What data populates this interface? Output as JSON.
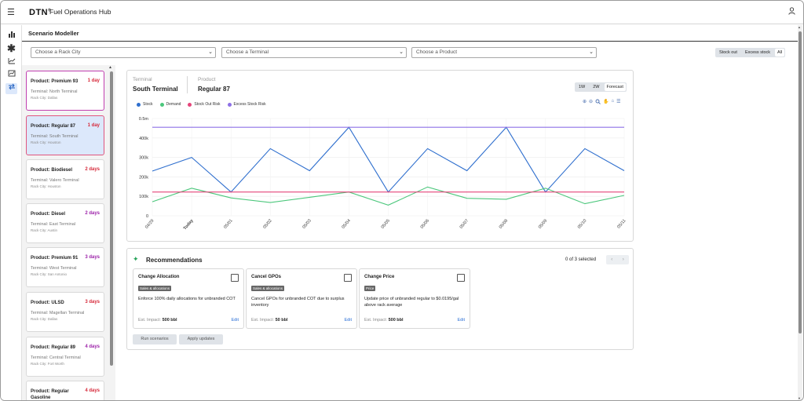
{
  "header": {
    "brand": "DTN",
    "brand_mark": "®",
    "title": "Fuel Operations Hub"
  },
  "page": {
    "title": "Scenario Modeller"
  },
  "filters": {
    "rack_city": "Choose a Rack City",
    "terminal": "Choose a Terminal",
    "product": "Choose a Product"
  },
  "stock_toggle": [
    "Stock out",
    "Excess stock",
    "All"
  ],
  "stock_toggle_selected": "All",
  "product_cards": [
    {
      "product": "Product: Premium 93",
      "days": "1 day",
      "days_color": "#d62839",
      "terminal": "Terminal: North Terminal",
      "city": "Rack City: Dallas"
    },
    {
      "product": "Product: Regular 87",
      "days": "1 day",
      "days_color": "#d62839",
      "terminal": "Terminal: South Terminal",
      "city": "Rack City: Houston"
    },
    {
      "product": "Product: Biodiesel",
      "days": "2 days",
      "days_color": "#d62839",
      "terminal": "Terminal: Valero Terminal",
      "city": "Rack City: Houston"
    },
    {
      "product": "Product: Diesel",
      "days": "2 days",
      "days_color": "#9b1fa8",
      "terminal": "Terminal: East Terminal",
      "city": "Rack City: Austin"
    },
    {
      "product": "Product: Premium 91",
      "days": "3 days",
      "days_color": "#9b1fa8",
      "terminal": "Terminal: West Terminal",
      "city": "Rack City: San Antonio"
    },
    {
      "product": "Product: ULSD",
      "days": "3 days",
      "days_color": "#d62839",
      "terminal": "Terminal: Magellan Terminal",
      "city": "Rack City: Dallas"
    },
    {
      "product": "Product: Regular 89",
      "days": "4 days",
      "days_color": "#9b1fa8",
      "terminal": "Terminal: Central Terminal",
      "city": "Rack City: Fort Worth"
    },
    {
      "product": "Product: Regular Gasoline",
      "days": "4 days",
      "days_color": "#d62839",
      "terminal": "",
      "city": ""
    }
  ],
  "detail": {
    "terminal_label": "Terminal",
    "terminal_value": "South Terminal",
    "product_label": "Product",
    "product_value": "Regular 87"
  },
  "range": [
    "1W",
    "2W",
    "Forecast"
  ],
  "range_selected": "Forecast",
  "chart_data": {
    "type": "line",
    "x": [
      "04/29",
      "Today",
      "05/01",
      "05/02",
      "05/03",
      "05/04",
      "05/05",
      "05/06",
      "05/07",
      "05/08",
      "05/09",
      "05/10",
      "05/11"
    ],
    "x_bold": "Today",
    "y_ticks": [
      "0",
      "100k",
      "200k",
      "300k",
      "400k",
      "0.5m"
    ],
    "ylim": [
      0,
      500000
    ],
    "grid": true,
    "legend_position": "top-left",
    "series": [
      {
        "name": "Stock",
        "color": "#2f6fce",
        "values": [
          230000,
          300000,
          122000,
          345000,
          232000,
          455000,
          122000,
          345000,
          232000,
          455000,
          122000,
          345000,
          232000
        ]
      },
      {
        "name": "Demand",
        "color": "#4cc77c",
        "values": [
          72000,
          142000,
          92000,
          68000,
          95000,
          122000,
          55000,
          148000,
          90000,
          85000,
          142000,
          62000,
          105000
        ]
      },
      {
        "name": "Stock Out Risk",
        "color": "#e5457a",
        "values": [
          122000,
          122000,
          122000,
          122000,
          122000,
          122000,
          122000,
          122000,
          122000,
          122000,
          122000,
          122000,
          122000
        ]
      },
      {
        "name": "Excess Stock Risk",
        "color": "#8d70e6",
        "values": [
          455000,
          455000,
          455000,
          455000,
          455000,
          455000,
          455000,
          455000,
          455000,
          455000,
          455000,
          455000,
          455000
        ]
      }
    ]
  },
  "recommendations": {
    "title": "Recommendations",
    "selected_text": "0 of 3 selected",
    "items": [
      {
        "title": "Change Allocation",
        "tag": "Sales & allocations",
        "desc": "Enforce 100% daily allocations for unbranded COT",
        "impact_label": "Est. Impact:",
        "impact_value": "500 bbl",
        "edit": "Edit"
      },
      {
        "title": "Cancel GPOs",
        "tag": "Sales & allocations",
        "desc": "Cancel GPOs for unbranded COT due to surplus inventory",
        "impact_label": "Est. Impact:",
        "impact_value": "50 bbl",
        "edit": "Edit"
      },
      {
        "title": "Change Price",
        "tag": "Price",
        "desc": "Update price of unbranded regular to $0.0195/gal above rack average",
        "impact_label": "Est. Impact:",
        "impact_value": "500 bbl",
        "edit": "Edit"
      }
    ],
    "run_button": "Run scenarios",
    "apply_button": "Apply updates"
  },
  "icons": {
    "menu": "menu-icon",
    "user": "user-icon",
    "sparkle": "sparkle-icon"
  }
}
